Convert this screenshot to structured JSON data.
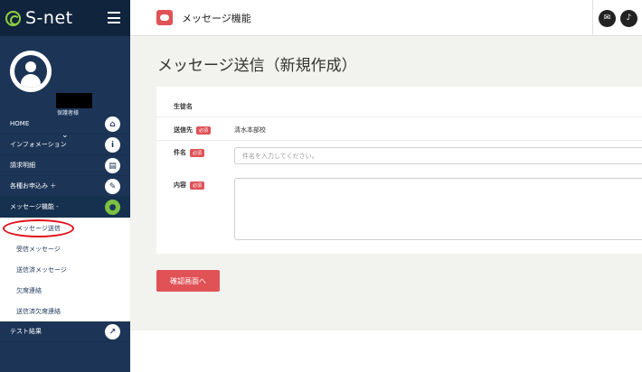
{
  "app": {
    "name": "S-net"
  },
  "profile": {
    "role": "保護者様"
  },
  "menu": {
    "items": [
      {
        "label": "HOME",
        "icon": "home-icon",
        "glyph": "⌂"
      },
      {
        "label": "インフォメーション",
        "icon": "info-icon",
        "glyph": "i"
      },
      {
        "label": "請求明細",
        "icon": "document-icon",
        "glyph": "▤"
      },
      {
        "label": "各種お申込み ＋",
        "icon": "edit-icon",
        "glyph": "✎"
      },
      {
        "label": "メッセージ機能 -",
        "icon": "chat-icon",
        "glyph": "●"
      }
    ],
    "submenu": [
      "メッセージ送信",
      "受信メッセージ",
      "送信済メッセージ",
      "欠席連絡",
      "送信済欠席連絡"
    ],
    "after": {
      "label": "テスト結果",
      "icon": "chart-icon",
      "glyph": "↗"
    }
  },
  "header": {
    "title": "メッセージ機能",
    "mail_glyph": "✉",
    "bell_glyph": "♪"
  },
  "page": {
    "title": "メッセージ送信（新規作成）"
  },
  "form": {
    "student_label": "生徒名",
    "recipient_label": "送信先",
    "recipient_value": "清水本部校",
    "subject_label": "件名",
    "subject_placeholder": "件名を入力してください。",
    "body_label": "内容",
    "required_badge": "必須"
  },
  "actions": {
    "confirm_label": "確認画面へ"
  },
  "colors": {
    "sidebar": "#1c3557",
    "accent": "#e05256",
    "active_icon": "#7cc242"
  }
}
